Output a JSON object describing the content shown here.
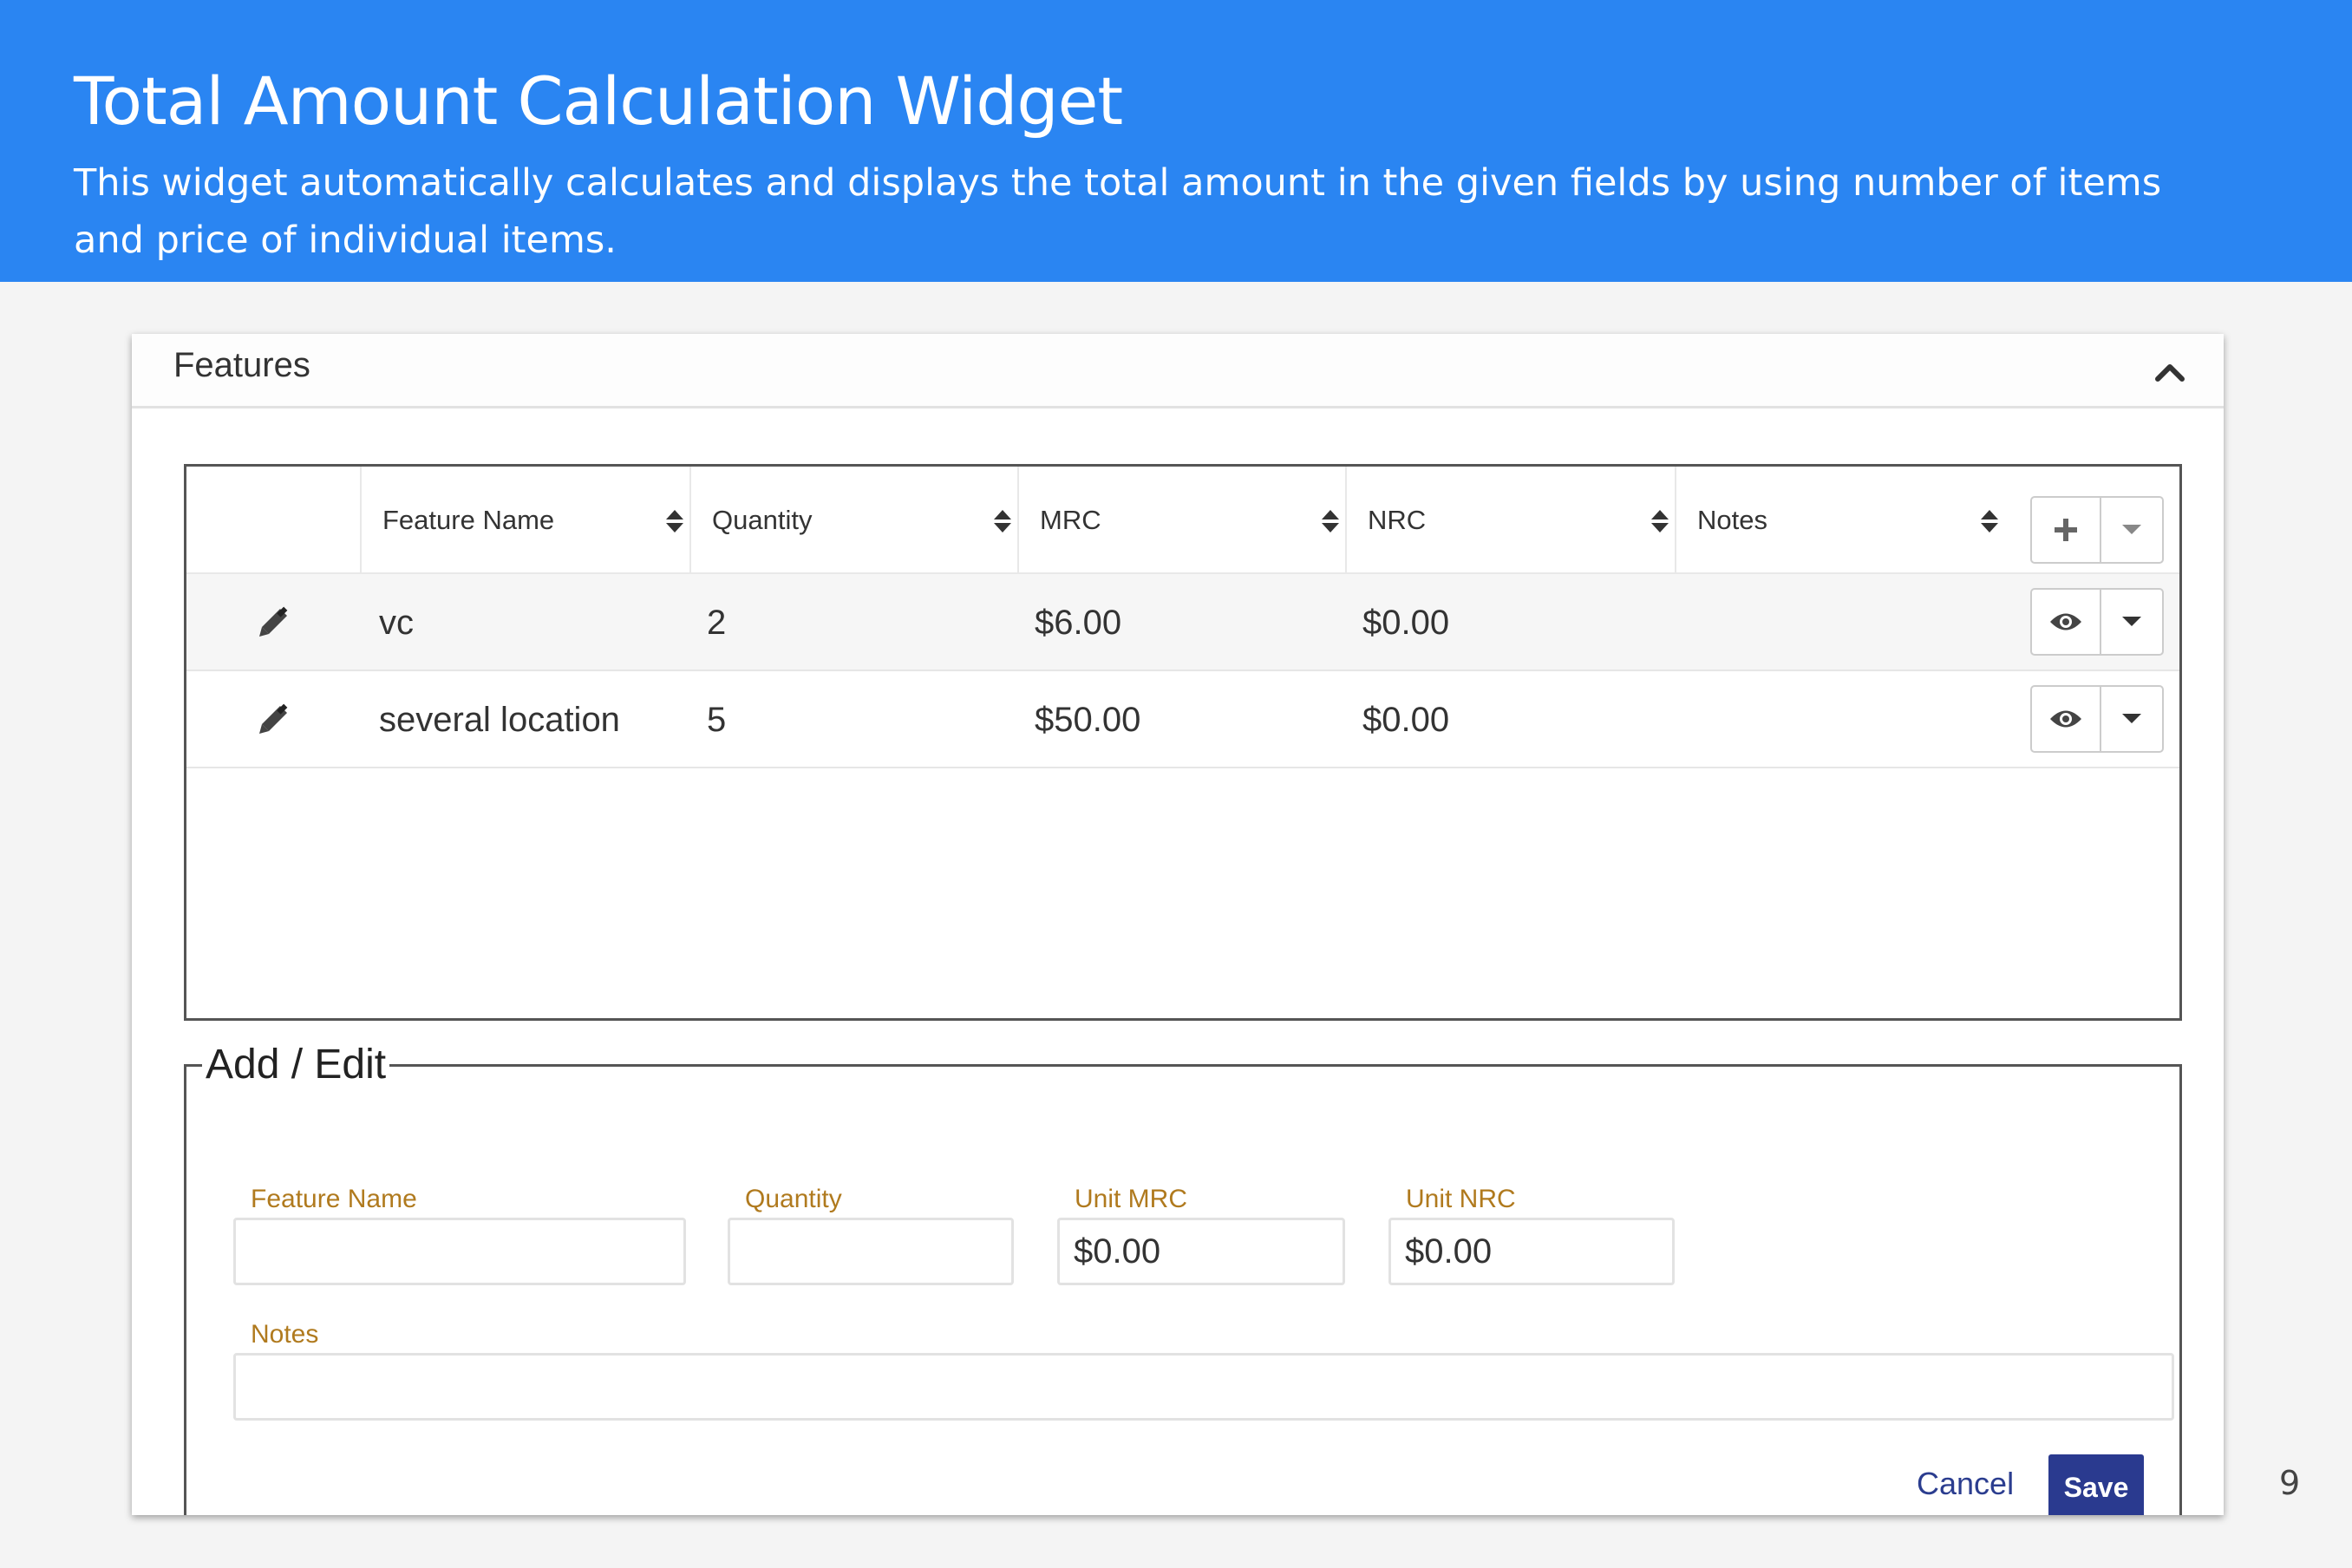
{
  "banner": {
    "title": "Total Amount Calculation Widget",
    "description": "This widget automatically calculates and displays the total amount in the given fields by using number of items and price of individual items."
  },
  "panel": {
    "title": "Features",
    "collapse_icon": "chevron-up-icon"
  },
  "table": {
    "columns": [
      "Feature Name",
      "Quantity",
      "MRC",
      "NRC",
      "Notes"
    ],
    "rows": [
      {
        "feature_name": "vc",
        "quantity": "2",
        "mrc": "$6.00",
        "nrc": "$0.00",
        "notes": ""
      },
      {
        "feature_name": "several location",
        "quantity": "5",
        "mrc": "$50.00",
        "nrc": "$0.00",
        "notes": ""
      }
    ]
  },
  "form": {
    "legend": "Add / Edit",
    "feature_name_label": "Feature Name",
    "feature_name_value": "",
    "quantity_label": "Quantity",
    "quantity_value": "",
    "unit_mrc_label": "Unit MRC",
    "unit_mrc_value": "$0.00",
    "unit_nrc_label": "Unit NRC",
    "unit_nrc_value": "$0.00",
    "notes_label": "Notes",
    "notes_value": "",
    "cancel_label": "Cancel",
    "save_label": "Save"
  },
  "colors": {
    "banner": "#2a85f2",
    "save_button": "#2a3a8f",
    "field_label": "#b07a1e"
  },
  "page_number": "9"
}
